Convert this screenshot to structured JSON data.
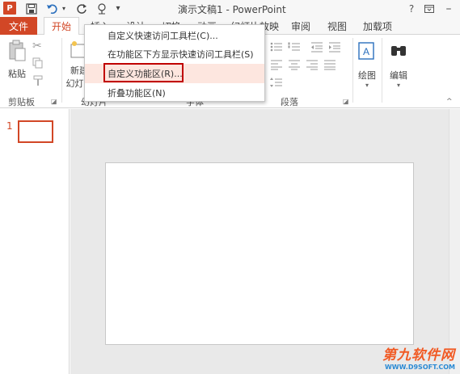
{
  "titlebar": {
    "app_icon": "P",
    "title": "演示文稿1 - PowerPoint",
    "help": "?",
    "icons": [
      "save-icon",
      "undo-icon",
      "redo-icon",
      "touch-mode-icon",
      "qat-dropdown-icon"
    ]
  },
  "tabs": {
    "file": "文件",
    "home": "开始",
    "insert": "插入",
    "design": "设计",
    "transitions": "切换",
    "animations": "动画",
    "slideshow": "幻灯片放映",
    "review": "审阅",
    "view": "视图",
    "addins": "加载项"
  },
  "ribbon": {
    "paste_label": "粘贴",
    "clipboard_label": "剪贴板",
    "new_slide_label": "新建",
    "new_slide_label2": "幻灯片",
    "slides_group_label": "幻灯片",
    "font_group_label": "字体",
    "paragraph_label": "段落",
    "drawing_label": "绘图",
    "editing_label": "编辑"
  },
  "menu": {
    "items": [
      "自定义快速访问工具栏(C)...",
      "在功能区下方显示快速访问工具栏(S)",
      "自定义功能区(R)...",
      "折叠功能区(N)"
    ]
  },
  "thumbnails": {
    "slide_number": "1"
  },
  "watermark": {
    "main": "第九软件网",
    "sub": "WWW.D9SOFT.COM"
  },
  "colors": {
    "accent": "#d24726",
    "highlight_box": "#c00000"
  }
}
